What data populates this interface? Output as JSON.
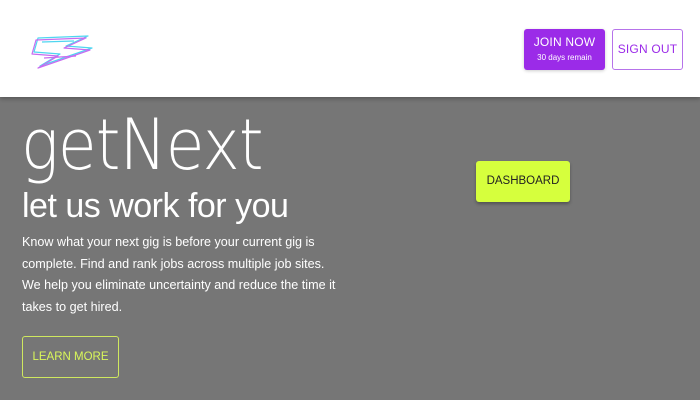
{
  "header": {
    "logo_icon": "lightning-bolt-icon",
    "join_button": {
      "label": "JOIN NOW",
      "sublabel": "30 days remain"
    },
    "signout_label": "SIGN OUT"
  },
  "hero": {
    "title": "getNext",
    "subtitle": "let us work for you",
    "description": "Know what your next gig is before your current gig is complete. Find and rank jobs across multiple job sites. We help you eliminate uncertainty and reduce the time it takes to get hired.",
    "learn_more_label": "LEARN MORE",
    "dashboard_label": "DASHBOARD"
  },
  "colors": {
    "header_bg": "#ffffff",
    "hero_bg": "#767676",
    "primary_purple": "#9b2be8",
    "accent_lime": "#d6ff3d"
  }
}
